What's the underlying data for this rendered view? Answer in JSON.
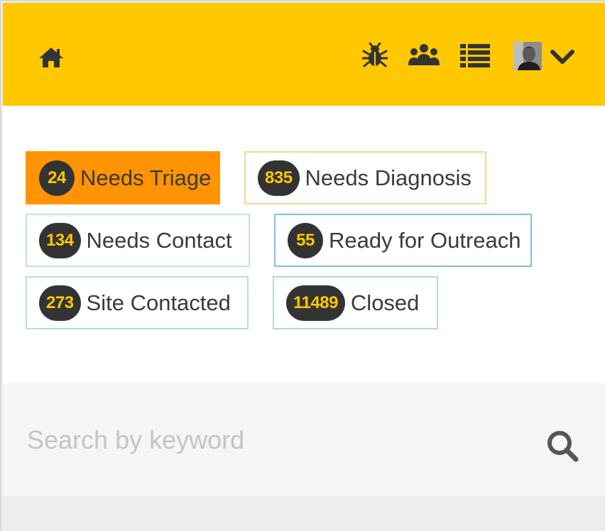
{
  "header": {
    "icons": [
      "home-icon",
      "bug-icon",
      "team-icon",
      "list-icon",
      "avatar",
      "chevron-down-icon"
    ],
    "background_color": "#ffc800"
  },
  "filters": [
    {
      "count": "24",
      "label": "Needs Triage",
      "active": true,
      "border_color": "#ff9400"
    },
    {
      "count": "835",
      "label": "Needs Diagnosis",
      "active": false,
      "border_color": "#f5d890"
    },
    {
      "count": "134",
      "label": "Needs Contact",
      "active": false,
      "border_color": "#bfe8cf"
    },
    {
      "count": "55",
      "label": "Ready for Outreach",
      "active": false,
      "border_color": "#7fbfe0"
    },
    {
      "count": "273",
      "label": "Site Contacted",
      "active": false,
      "border_color": "#b8dde8"
    },
    {
      "count": "11489",
      "label": "Closed",
      "active": false,
      "border_color": "#b5d6dc"
    }
  ],
  "search": {
    "placeholder": "Search by keyword",
    "value": ""
  },
  "colors": {
    "accent": "#ffc800",
    "active_filter": "#ff9400",
    "badge_bg": "#333333",
    "badge_text": "#ffc800"
  }
}
